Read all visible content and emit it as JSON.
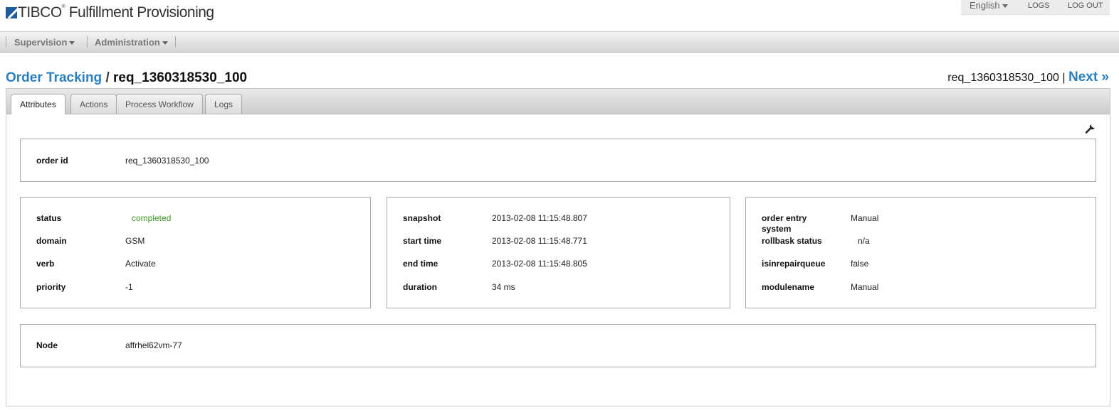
{
  "header": {
    "logo_brand": "TIBCO",
    "logo_reg": "®",
    "logo_product": "Fulfillment Provisioning",
    "language": "English",
    "logs_label": "LOGS",
    "logout_label": "LOG OUT"
  },
  "nav": {
    "supervision": "Supervision",
    "administration": "Administration"
  },
  "breadcrumb": {
    "link": "Order Tracking",
    "separator": "/",
    "current": "req_1360318530_100"
  },
  "pager": {
    "current_id": "req_1360318530_100",
    "separator": "|",
    "next": "Next »"
  },
  "tabs": [
    {
      "label": "Attributes",
      "active": true
    },
    {
      "label": "Actions",
      "active": false
    },
    {
      "label": "Process Workflow",
      "active": false
    },
    {
      "label": "Logs",
      "active": false
    }
  ],
  "icons": {
    "settings": "wrench-icon"
  },
  "colors": {
    "link": "#2b80c2",
    "status_completed": "#3a9a1d"
  },
  "order_box": {
    "label": "order id",
    "value": "req_1360318530_100"
  },
  "col1": [
    {
      "label": "status",
      "value": "completed"
    },
    {
      "label": "domain",
      "value": "GSM"
    },
    {
      "label": "verb",
      "value": "Activate"
    },
    {
      "label": "priority",
      "value": "-1"
    }
  ],
  "col2": [
    {
      "label": "snapshot",
      "value": "2013-02-08 11:15:48.807"
    },
    {
      "label": "start time",
      "value": "2013-02-08 11:15:48.771"
    },
    {
      "label": "end time",
      "value": "2013-02-08 11:15:48.805"
    },
    {
      "label": "duration",
      "value": "34 ms"
    }
  ],
  "col3": [
    {
      "label": "order entry system",
      "value": "Manual"
    },
    {
      "label": "rollbask status",
      "value": "n/a"
    },
    {
      "label": "isinrepairqueue",
      "value": "false"
    },
    {
      "label": "modulename",
      "value": "Manual"
    }
  ],
  "node_box": {
    "label": "Node",
    "value": "affrhel62vm-77"
  }
}
